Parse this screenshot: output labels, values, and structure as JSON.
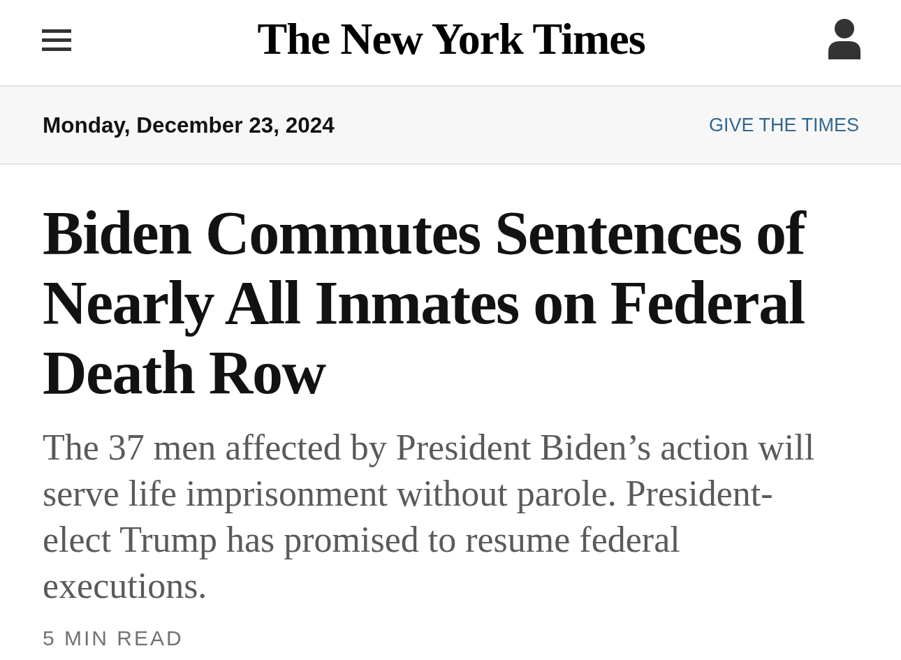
{
  "header": {
    "logo": "The New York Times"
  },
  "date_bar": {
    "date": "Monday, December 23, 2024",
    "link": "GIVE THE TIMES"
  },
  "article": {
    "headline": "Biden Commutes Sentences of Nearly All Inmates on Federal Death Row",
    "summary": "The 37 men affected by President Biden’s action will serve life imprisonment without parole. President-elect Trump has promised to resume federal executions.",
    "read_time": "5 MIN READ"
  }
}
